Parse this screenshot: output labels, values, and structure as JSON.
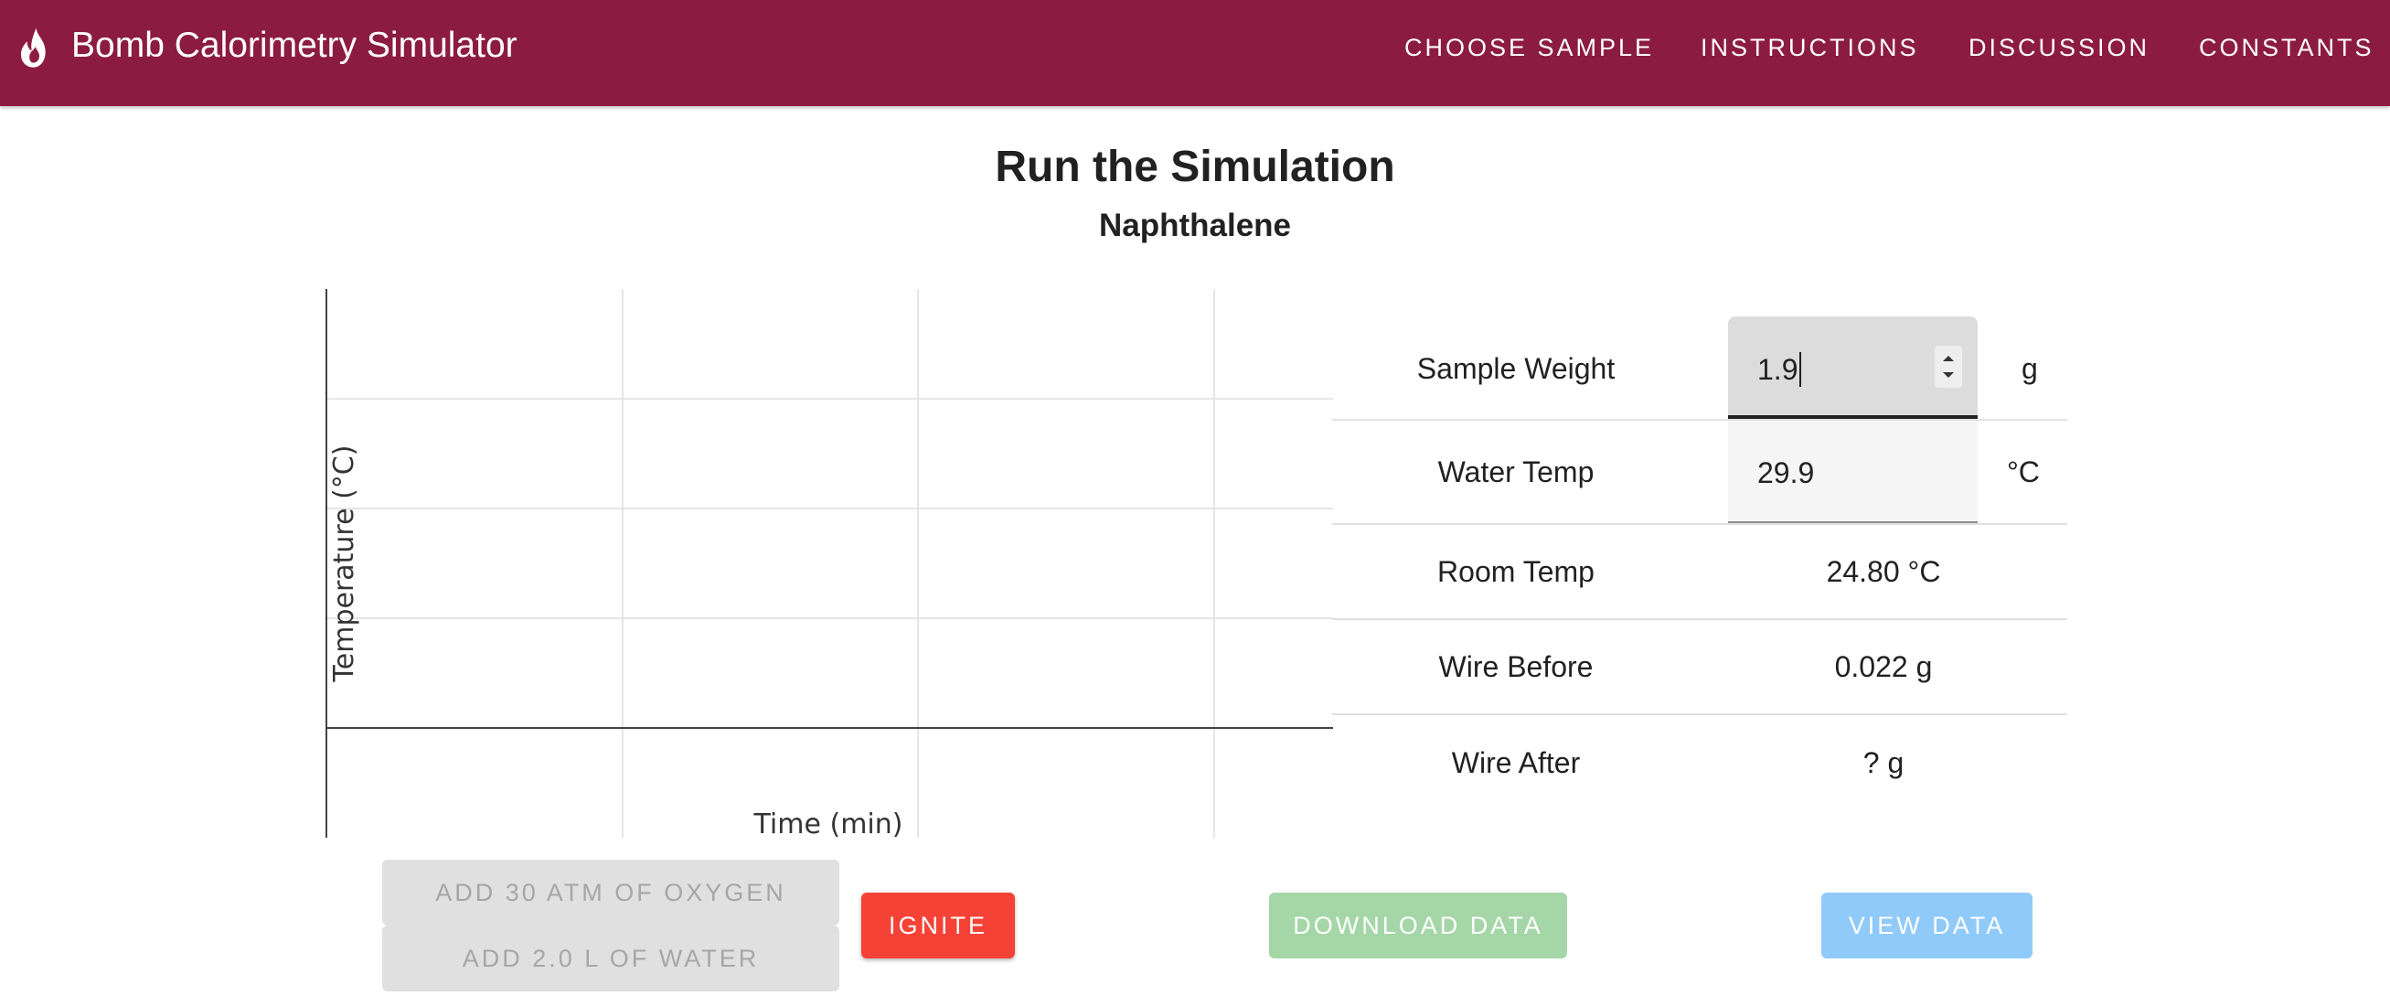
{
  "app": {
    "title": "Bomb Calorimetry Simulator",
    "brand_icon": "flame-icon",
    "bar_color": "#8c1b42"
  },
  "nav": {
    "choose_sample": "CHOOSE SAMPLE",
    "instructions": "INSTRUCTIONS",
    "discussion": "DISCUSSION",
    "constants": "CONSTANTS"
  },
  "page": {
    "title": "Run the Simulation",
    "sample_name": "Naphthalene"
  },
  "chart_data": {
    "type": "line",
    "xlabel": "Time (min)",
    "ylabel": "Temperature (°C)",
    "series": [],
    "grid": true
  },
  "table": {
    "sample_weight": {
      "label": "Sample Weight",
      "value": "1.9",
      "unit": "g"
    },
    "water_temp": {
      "label": "Water Temp",
      "value": "29.9",
      "unit": "°C"
    },
    "room_temp": {
      "label": "Room Temp",
      "value": "24.80 °C"
    },
    "wire_before": {
      "label": "Wire Before",
      "value": "0.022 g"
    },
    "wire_after": {
      "label": "Wire After",
      "value": "? g"
    }
  },
  "buttons": {
    "add_oxygen": "ADD 30 ATM OF OXYGEN",
    "add_water": "ADD 2.0 L OF WATER",
    "ignite": "IGNITE",
    "download": "DOWNLOAD DATA",
    "view": "VIEW DATA"
  },
  "colors": {
    "ignite": "#f44336",
    "download": "#a5d6a7",
    "view": "#90caf9",
    "disabled": "#e0e0e0"
  }
}
